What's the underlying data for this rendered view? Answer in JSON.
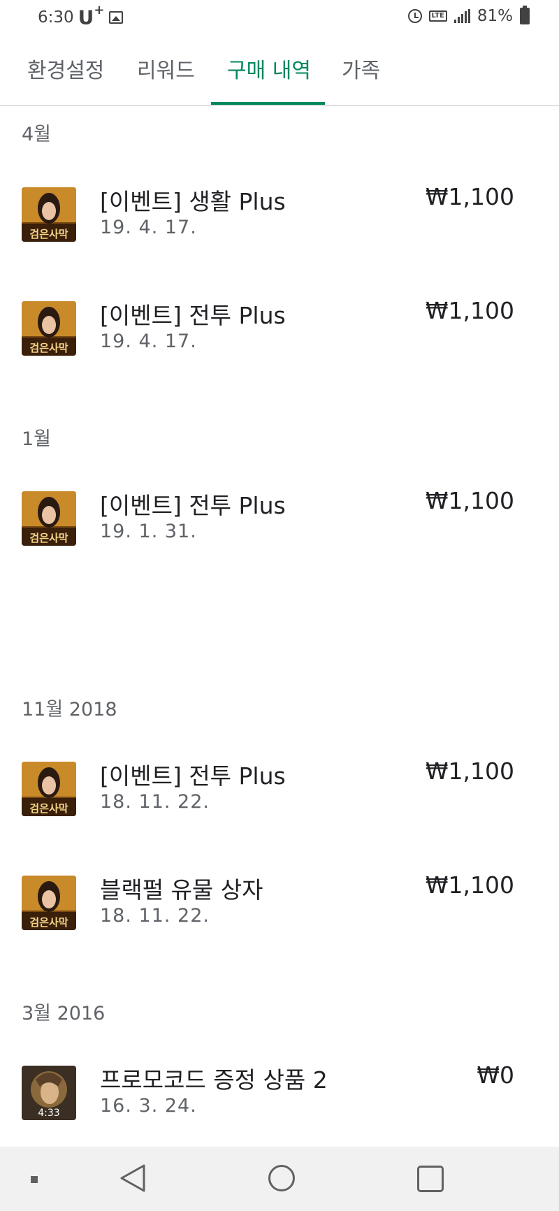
{
  "status_bar": {
    "time": "6:30",
    "carrier": "U",
    "carrier_plus": "+",
    "lte": "LTE",
    "battery": "81%"
  },
  "tabs": [
    {
      "label": "환경설정"
    },
    {
      "label": "리워드"
    },
    {
      "label": "구매 내역",
      "active": true
    },
    {
      "label": "가족"
    }
  ],
  "sections": [
    {
      "header": "4월",
      "items": [
        {
          "title": "[이벤트] 생활 Plus",
          "date": "19. 4. 17.",
          "price": "₩1,100",
          "thumb_label": "검은사막"
        },
        {
          "title": "[이벤트] 전투 Plus",
          "date": "19. 4. 17.",
          "price": "₩1,100",
          "thumb_label": "검은사막"
        }
      ]
    },
    {
      "header": "1월",
      "items": [
        {
          "title": "[이벤트] 전투 Plus",
          "date": "19. 1. 31.",
          "price": "₩1,100",
          "thumb_label": "검은사막"
        }
      ]
    },
    {
      "header": "11월 2018",
      "items": [
        {
          "title": "[이벤트] 전투 Plus",
          "date": "18. 11. 22.",
          "price": "₩1,100",
          "thumb_label": "검은사막"
        },
        {
          "title": "블랙펄 유물 상자",
          "date": "18. 11. 22.",
          "price": "₩1,100",
          "thumb_label": "검은사막"
        }
      ]
    },
    {
      "header": "3월 2016",
      "items": [
        {
          "title": "프로모코드 증정 상품 2",
          "date": "16. 3. 24.",
          "price": "₩0",
          "thumb_label": "4:33"
        }
      ]
    }
  ],
  "colors": {
    "accent": "#01875f",
    "secondary_text": "#5f6368",
    "primary_text": "#202124"
  }
}
